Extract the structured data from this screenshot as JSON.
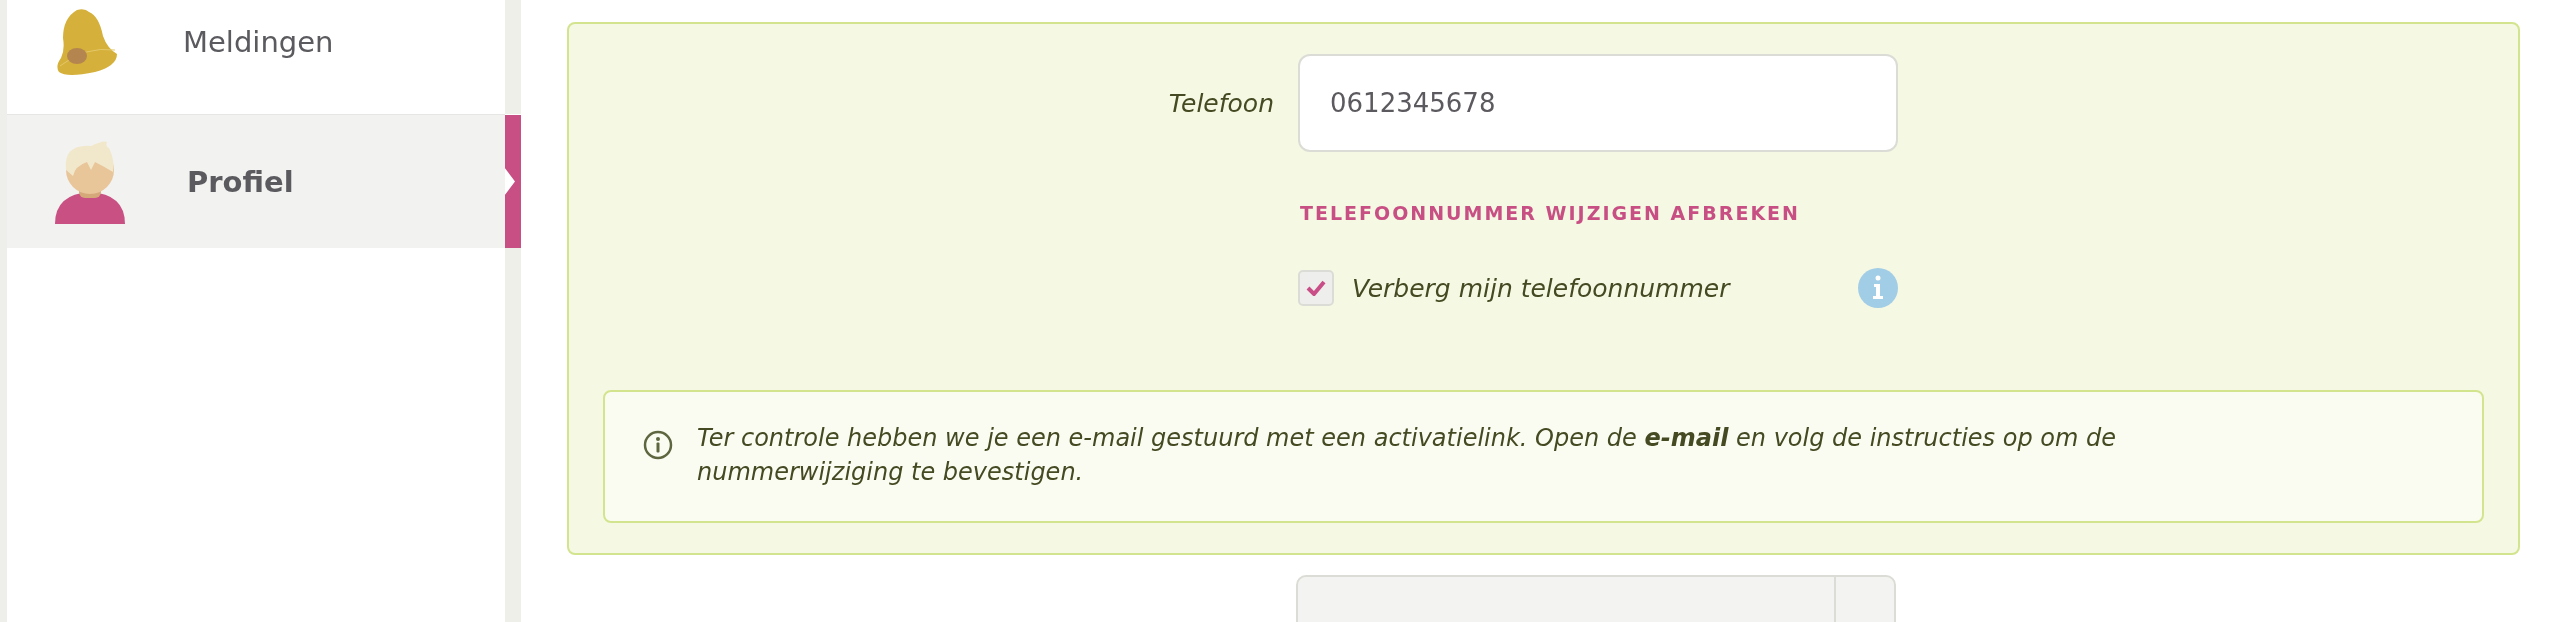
{
  "sidebar": {
    "items": [
      {
        "label": "Meldingen",
        "kind": "bell",
        "selected": false
      },
      {
        "label": "Profiel",
        "kind": "person",
        "selected": true
      }
    ]
  },
  "form": {
    "phone": {
      "label": "Telefoon",
      "value": "0612345678"
    },
    "cancel_link": "TELEFOONNUMMER WIJZIGEN AFBREKEN",
    "hide_phone": {
      "label": "Verberg mijn telefoonnummer",
      "checked": true
    },
    "notice": "Ter controle hebben we je een e-mail gestuurd met een activatielink. Open de **e-mail** en volg de instructies op om de nummerwijziging te bevestigen."
  }
}
